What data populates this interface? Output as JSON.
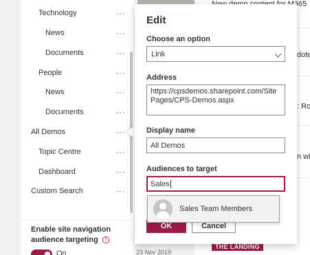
{
  "nav": {
    "items": [
      {
        "label": "Technology"
      },
      {
        "label": "News"
      },
      {
        "label": "Documents"
      },
      {
        "label": "People"
      },
      {
        "label": "News"
      },
      {
        "label": "Documents"
      },
      {
        "label": "All Demos"
      },
      {
        "label": "Topic Centre"
      },
      {
        "label": "Dashboard"
      },
      {
        "label": "Custom Search"
      }
    ],
    "more_glyph": "···",
    "audience_targeting_label": "Enable site navigation audience targeting",
    "info_glyph": "i",
    "toggle_state": "On"
  },
  "background": {
    "headline": "New demo content for M365",
    "snippet_1": "dote",
    "snippet_2": ": Ro",
    "snippet_3": "n wit",
    "date": "23 Nov 2019",
    "badge": "THE LANDING"
  },
  "dialog": {
    "title": "Edit",
    "option_label": "Choose an option",
    "option_value": "Link",
    "address_label": "Address",
    "address_value": "https://cpsdemos.sharepoint.com/SitePages/CPS-Demos.aspx",
    "display_name_label": "Display name",
    "display_name_value": "All Demos",
    "audiences_label": "Audiences to target",
    "audiences_value": "Sales",
    "suggestion": "Sales Team Members",
    "ok_label": "OK",
    "cancel_label": "Cancel"
  },
  "colors": {
    "accent": "#9b1b4a",
    "info": "#c43148"
  }
}
